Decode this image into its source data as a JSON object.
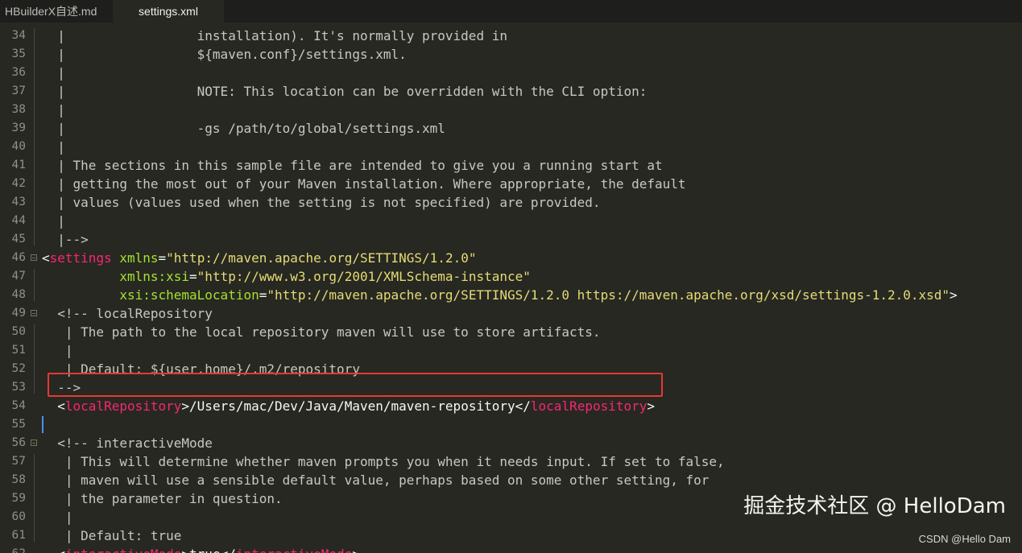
{
  "tabs": [
    {
      "label": "HBuilderX自述.md",
      "active": false
    },
    {
      "label": "settings.xml",
      "active": true
    }
  ],
  "editor": {
    "file": "settings.xml",
    "highlighted_line": 54,
    "cursor_line": 55,
    "lines": [
      {
        "n": 34,
        "tokens": [
          {
            "t": "c",
            "v": "  |                 installation). It's normally provided in"
          }
        ]
      },
      {
        "n": 35,
        "tokens": [
          {
            "t": "c",
            "v": "  |                 ${maven.conf}/settings.xml."
          }
        ]
      },
      {
        "n": 36,
        "tokens": [
          {
            "t": "c",
            "v": "  |"
          }
        ]
      },
      {
        "n": 37,
        "tokens": [
          {
            "t": "c",
            "v": "  |                 NOTE: This location can be overridden with the CLI option:"
          }
        ]
      },
      {
        "n": 38,
        "tokens": [
          {
            "t": "c",
            "v": "  |"
          }
        ]
      },
      {
        "n": 39,
        "tokens": [
          {
            "t": "c",
            "v": "  |                 -gs /path/to/global/settings.xml"
          }
        ]
      },
      {
        "n": 40,
        "tokens": [
          {
            "t": "c",
            "v": "  |"
          }
        ]
      },
      {
        "n": 41,
        "tokens": [
          {
            "t": "c",
            "v": "  | The sections in this sample file are intended to give you a running start at"
          }
        ]
      },
      {
        "n": 42,
        "tokens": [
          {
            "t": "c",
            "v": "  | getting the most out of your Maven installation. Where appropriate, the default"
          }
        ]
      },
      {
        "n": 43,
        "tokens": [
          {
            "t": "c",
            "v": "  | values (values used when the setting is not specified) are provided."
          }
        ]
      },
      {
        "n": 44,
        "tokens": [
          {
            "t": "c",
            "v": "  |"
          }
        ]
      },
      {
        "n": 45,
        "tokens": [
          {
            "t": "c",
            "v": "  |-->"
          }
        ]
      },
      {
        "n": 46,
        "fold": true,
        "tokens": [
          {
            "t": "p",
            "v": "<"
          },
          {
            "t": "t",
            "v": "settings"
          },
          {
            "t": "p",
            "v": " "
          },
          {
            "t": "a",
            "v": "xmlns"
          },
          {
            "t": "p",
            "v": "="
          },
          {
            "t": "s",
            "v": "\"http://maven.apache.org/SETTINGS/1.2.0\""
          }
        ]
      },
      {
        "n": 47,
        "tokens": [
          {
            "t": "p",
            "v": "          "
          },
          {
            "t": "a",
            "v": "xmlns:xsi"
          },
          {
            "t": "p",
            "v": "="
          },
          {
            "t": "s",
            "v": "\"http://www.w3.org/2001/XMLSchema-instance\""
          }
        ]
      },
      {
        "n": 48,
        "tokens": [
          {
            "t": "p",
            "v": "          "
          },
          {
            "t": "a",
            "v": "xsi:schemaLocation"
          },
          {
            "t": "p",
            "v": "="
          },
          {
            "t": "s",
            "v": "\"http://maven.apache.org/SETTINGS/1.2.0 https://maven.apache.org/xsd/settings-1.2.0.xsd\""
          },
          {
            "t": "p",
            "v": ">"
          }
        ]
      },
      {
        "n": 49,
        "fold": true,
        "tokens": [
          {
            "t": "c",
            "v": "  <!-- localRepository"
          }
        ]
      },
      {
        "n": 50,
        "tokens": [
          {
            "t": "c",
            "v": "   | The path to the local repository maven will use to store artifacts."
          }
        ]
      },
      {
        "n": 51,
        "tokens": [
          {
            "t": "c",
            "v": "   |"
          }
        ]
      },
      {
        "n": 52,
        "tokens": [
          {
            "t": "c",
            "v": "   | Default: ${user.home}/.m2/repository"
          }
        ]
      },
      {
        "n": 53,
        "tokens": [
          {
            "t": "c",
            "v": "  -->"
          }
        ]
      },
      {
        "n": 54,
        "tokens": [
          {
            "t": "p",
            "v": "  <"
          },
          {
            "t": "t",
            "v": "localRepository"
          },
          {
            "t": "p",
            "v": ">/Users/mac/Dev/Java/Maven/maven-repository</"
          },
          {
            "t": "t",
            "v": "localRepository"
          },
          {
            "t": "p",
            "v": ">"
          }
        ]
      },
      {
        "n": 55,
        "tokens": [
          {
            "t": "p",
            "v": ""
          }
        ]
      },
      {
        "n": 56,
        "fold": true,
        "tokens": [
          {
            "t": "c",
            "v": "  <!-- interactiveMode"
          }
        ]
      },
      {
        "n": 57,
        "tokens": [
          {
            "t": "c",
            "v": "   | This will determine whether maven prompts you when it needs input. If set to false,"
          }
        ]
      },
      {
        "n": 58,
        "tokens": [
          {
            "t": "c",
            "v": "   | maven will use a sensible default value, perhaps based on some other setting, for"
          }
        ]
      },
      {
        "n": 59,
        "tokens": [
          {
            "t": "c",
            "v": "   | the parameter in question."
          }
        ]
      },
      {
        "n": 60,
        "tokens": [
          {
            "t": "c",
            "v": "   |"
          }
        ]
      },
      {
        "n": 61,
        "tokens": [
          {
            "t": "c",
            "v": "   | Default: true"
          }
        ]
      },
      {
        "n": 62,
        "tokens": [
          {
            "t": "p",
            "v": "  <"
          },
          {
            "t": "t",
            "v": "interactiveMode"
          },
          {
            "t": "p",
            "v": ">true</"
          },
          {
            "t": "t",
            "v": "interactiveMode"
          },
          {
            "t": "p",
            "v": ">"
          }
        ]
      }
    ]
  },
  "watermark": {
    "main": "掘金技术社区 @ HelloDam",
    "sub": "CSDN @Hello Dam"
  },
  "colors": {
    "background": "#272822",
    "comment": "#c8c8c2",
    "tag": "#f92672",
    "attribute": "#a6e22e",
    "string": "#e6db74",
    "highlight_box": "#e53935",
    "cursor": "#4d8ef7"
  }
}
